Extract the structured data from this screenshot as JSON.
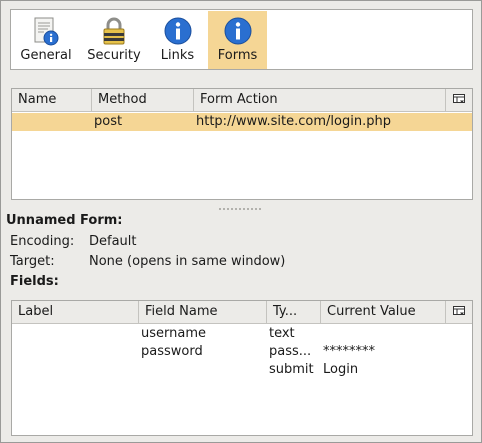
{
  "toolbar": {
    "tabs": [
      {
        "label": "General",
        "icon": "document-info-icon",
        "active": false
      },
      {
        "label": "Security",
        "icon": "padlock-icon",
        "active": false
      },
      {
        "label": "Links",
        "icon": "info-icon",
        "active": false
      },
      {
        "label": "Forms",
        "icon": "info-icon",
        "active": true
      }
    ]
  },
  "forms_table": {
    "columns": [
      "Name",
      "Method",
      "Form Action"
    ],
    "rows": [
      {
        "name": "",
        "method": "post",
        "action": "http://www.site.com/login.php",
        "selected": true
      }
    ]
  },
  "form_details": {
    "heading": "Unnamed Form:",
    "encoding_label": "Encoding:",
    "encoding_value": "Default",
    "target_label": "Target:",
    "target_value": "None (opens in same window)",
    "fields_heading": "Fields:"
  },
  "fields_table": {
    "columns": [
      "Label",
      "Field Name",
      "Ty...",
      "Current Value"
    ],
    "rows": [
      {
        "label": "",
        "field_name": "username",
        "type": "text",
        "value": ""
      },
      {
        "label": "",
        "field_name": "password",
        "type": "pass...",
        "value": "********"
      },
      {
        "label": "",
        "field_name": "",
        "type": "submit",
        "value": "Login"
      }
    ]
  },
  "colors": {
    "selection": "#f5d695",
    "window_bg": "#ecebe8",
    "info_icon_blue": "#2a6fd0"
  }
}
